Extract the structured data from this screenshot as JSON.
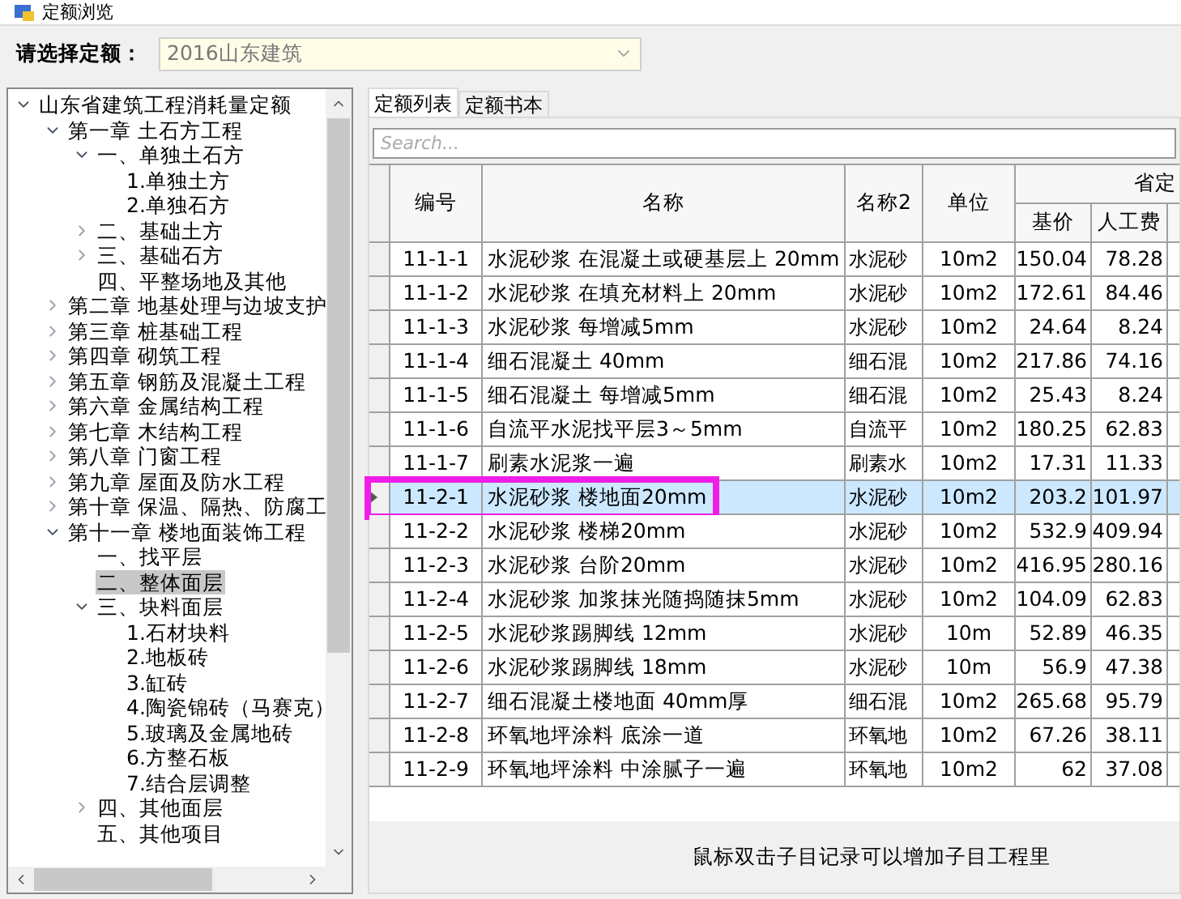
{
  "window": {
    "title": "定额浏览"
  },
  "quota_select": {
    "label": "请选择定额：",
    "value": "2016山东建筑"
  },
  "tree": [
    {
      "label": "山东省建筑工程消耗量定额",
      "expanded": true,
      "selected": false,
      "children": [
        {
          "label": "第一章 土石方工程",
          "expanded": true,
          "selected": false,
          "children": [
            {
              "label": "一、单独土石方",
              "expanded": true,
              "selected": false,
              "children": [
                {
                  "label": "1.单独土方",
                  "selected": false
                },
                {
                  "label": "2.单独石方",
                  "selected": false
                }
              ]
            },
            {
              "label": "二、基础土方",
              "expanded": false,
              "selected": false
            },
            {
              "label": "三、基础石方",
              "expanded": false,
              "selected": false
            },
            {
              "label": "四、平整场地及其他",
              "selected": false
            }
          ]
        },
        {
          "label": "第二章 地基处理与边坡支护",
          "expanded": false,
          "selected": false
        },
        {
          "label": "第三章 桩基础工程",
          "expanded": false,
          "selected": false
        },
        {
          "label": "第四章 砌筑工程",
          "expanded": false,
          "selected": false
        },
        {
          "label": "第五章 钢筋及混凝土工程",
          "expanded": false,
          "selected": false
        },
        {
          "label": "第六章 金属结构工程",
          "expanded": false,
          "selected": false
        },
        {
          "label": "第七章 木结构工程",
          "expanded": false,
          "selected": false
        },
        {
          "label": "第八章 门窗工程",
          "expanded": false,
          "selected": false
        },
        {
          "label": "第九章 屋面及防水工程",
          "expanded": false,
          "selected": false
        },
        {
          "label": "第十章 保温、隔热、防腐工",
          "expanded": false,
          "selected": false
        },
        {
          "label": "第十一章 楼地面装饰工程",
          "expanded": true,
          "selected": false,
          "children": [
            {
              "label": "一、找平层",
              "selected": false
            },
            {
              "label": "二、整体面层",
              "selected": true
            },
            {
              "label": "三、块料面层",
              "expanded": true,
              "selected": false,
              "children": [
                {
                  "label": "1.石材块料",
                  "selected": false
                },
                {
                  "label": "2.地板砖",
                  "selected": false
                },
                {
                  "label": "3.缸砖",
                  "selected": false
                },
                {
                  "label": "4.陶瓷锦砖（马赛克）",
                  "selected": false
                },
                {
                  "label": "5.玻璃及金属地砖",
                  "selected": false
                },
                {
                  "label": "6.方整石板",
                  "selected": false
                },
                {
                  "label": "7.结合层调整",
                  "selected": false
                }
              ]
            },
            {
              "label": "四、其他面层",
              "expanded": false,
              "selected": false
            },
            {
              "label": "五、其他项目",
              "selected": false
            }
          ]
        }
      ]
    }
  ],
  "tabs": [
    {
      "label": "定额列表",
      "selected": true
    },
    {
      "label": "定额书本",
      "selected": false
    }
  ],
  "search": {
    "placeholder": "Search..."
  },
  "table": {
    "columns": [
      "编号",
      "名称",
      "名称2",
      "单位"
    ],
    "group_header": "省定",
    "sub_columns": [
      "基价",
      "人工费"
    ],
    "rows": [
      {
        "code": "11-1-1",
        "name": "水泥砂浆 在混凝土或硬基层上 20mm",
        "name2": "水泥砂",
        "unit": "10m2",
        "base_price": "150.04",
        "labor": "78.28",
        "selected": false,
        "highlighted": false
      },
      {
        "code": "11-1-2",
        "name": "水泥砂浆 在填充材料上 20mm",
        "name2": "水泥砂",
        "unit": "10m2",
        "base_price": "172.61",
        "labor": "84.46",
        "selected": false,
        "highlighted": false
      },
      {
        "code": "11-1-3",
        "name": "水泥砂浆 每增减5mm",
        "name2": "水泥砂",
        "unit": "10m2",
        "base_price": "24.64",
        "labor": "8.24",
        "selected": false,
        "highlighted": false
      },
      {
        "code": "11-1-4",
        "name": "细石混凝土 40mm",
        "name2": "细石混",
        "unit": "10m2",
        "base_price": "217.86",
        "labor": "74.16",
        "selected": false,
        "highlighted": false
      },
      {
        "code": "11-1-5",
        "name": "细石混凝土 每增减5mm",
        "name2": "细石混",
        "unit": "10m2",
        "base_price": "25.43",
        "labor": "8.24",
        "selected": false,
        "highlighted": false
      },
      {
        "code": "11-1-6",
        "name": "自流平水泥找平层3～5mm",
        "name2": "自流平",
        "unit": "10m2",
        "base_price": "180.25",
        "labor": "62.83",
        "selected": false,
        "highlighted": false
      },
      {
        "code": "11-1-7",
        "name": "刷素水泥浆一遍",
        "name2": "刷素水",
        "unit": "10m2",
        "base_price": "17.31",
        "labor": "11.33",
        "selected": false,
        "highlighted": false
      },
      {
        "code": "11-2-1",
        "name": "水泥砂浆 楼地面20mm",
        "name2": "水泥砂",
        "unit": "10m2",
        "base_price": "203.2",
        "labor": "101.97",
        "selected": true,
        "highlighted": true
      },
      {
        "code": "11-2-2",
        "name": "水泥砂浆 楼梯20mm",
        "name2": "水泥砂",
        "unit": "10m2",
        "base_price": "532.9",
        "labor": "409.94",
        "selected": false,
        "highlighted": false
      },
      {
        "code": "11-2-3",
        "name": "水泥砂浆 台阶20mm",
        "name2": "水泥砂",
        "unit": "10m2",
        "base_price": "416.95",
        "labor": "280.16",
        "selected": false,
        "highlighted": false
      },
      {
        "code": "11-2-4",
        "name": "水泥砂浆 加浆抹光随捣随抹5mm",
        "name2": "水泥砂",
        "unit": "10m2",
        "base_price": "104.09",
        "labor": "62.83",
        "selected": false,
        "highlighted": false
      },
      {
        "code": "11-2-5",
        "name": "水泥砂浆踢脚线 12mm",
        "name2": "水泥砂",
        "unit": "10m",
        "base_price": "52.89",
        "labor": "46.35",
        "selected": false,
        "highlighted": false
      },
      {
        "code": "11-2-6",
        "name": "水泥砂浆踢脚线 18mm",
        "name2": "水泥砂",
        "unit": "10m",
        "base_price": "56.9",
        "labor": "47.38",
        "selected": false,
        "highlighted": false
      },
      {
        "code": "11-2-7",
        "name": "细石混凝土楼地面 40mm厚",
        "name2": "细石混",
        "unit": "10m2",
        "base_price": "265.68",
        "labor": "95.79",
        "selected": false,
        "highlighted": false
      },
      {
        "code": "11-2-8",
        "name": "环氧地坪涂料 底涂一道",
        "name2": "环氧地",
        "unit": "10m2",
        "base_price": "67.26",
        "labor": "38.11",
        "selected": false,
        "highlighted": false
      },
      {
        "code": "11-2-9",
        "name": "环氧地坪涂料 中涂腻子一遍",
        "name2": "环氧地",
        "unit": "10m2",
        "base_price": "62",
        "labor": "37.08",
        "selected": false,
        "highlighted": false
      }
    ]
  },
  "hint": "鼠标双击子目记录可以增加子目工程里"
}
